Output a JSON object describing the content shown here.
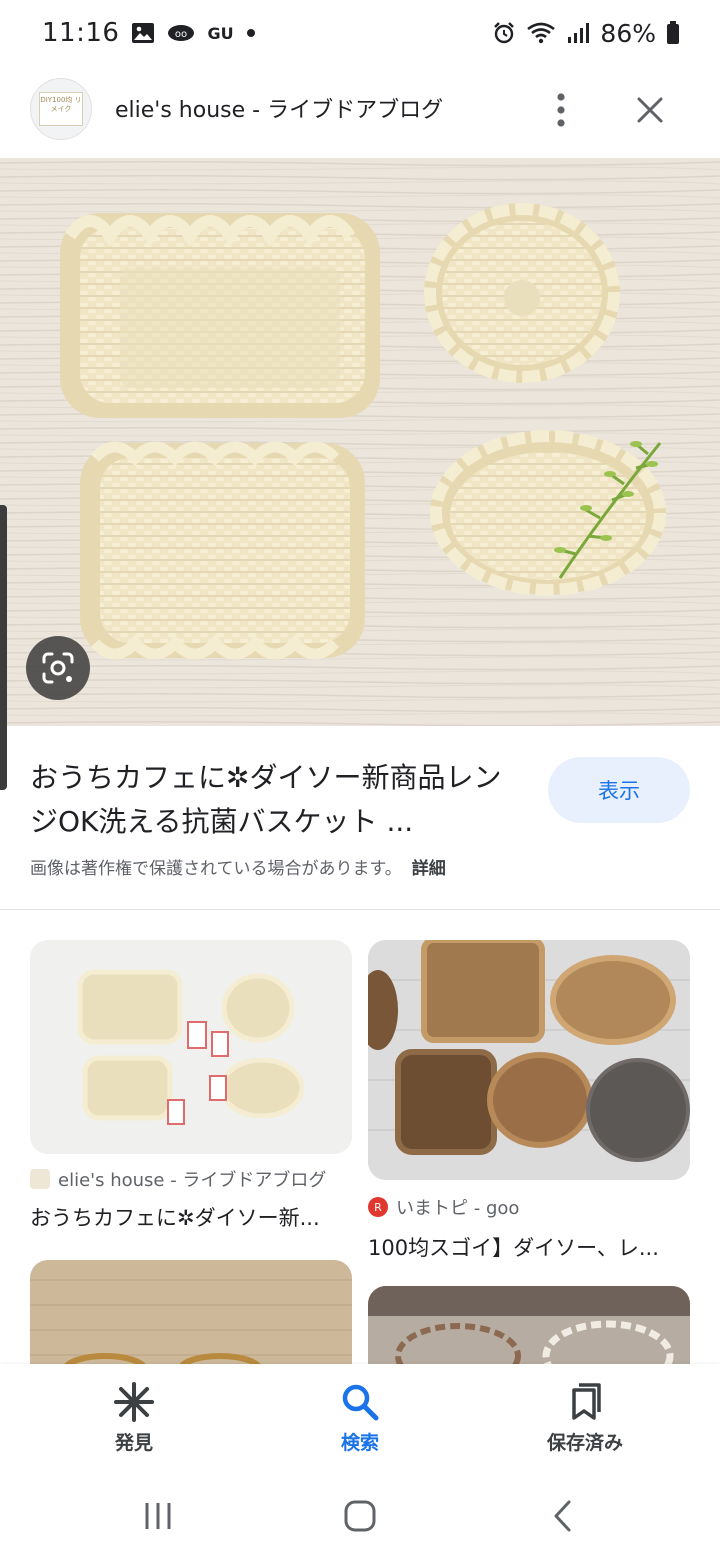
{
  "status_bar": {
    "time": "11:16",
    "carrier_small": "GU",
    "battery": "86%"
  },
  "header": {
    "site_title": "elie's house - ライブドアブログ",
    "avatar_text": "DIY100均 リメイク"
  },
  "caption": {
    "title_line1": "おうちカフェに✲ダイソー新商品レン",
    "title_line2": "ジOK洗える抗菌バスケット ...",
    "show_button": "表示",
    "copyright": "画像は著作権で保護されている場合があります。",
    "detail_link": "詳細"
  },
  "results": [
    {
      "source": "elie's house - ライブドアブログ",
      "title": "おうちカフェに✲ダイソー新..."
    },
    {
      "source": "いまトピ - goo",
      "title": "100均スゴイ】ダイソー、レ..."
    }
  ],
  "bottom_nav": {
    "discover": "発見",
    "search": "検索",
    "saved": "保存済み"
  },
  "colors": {
    "accent": "#1a73e8",
    "pill_bg": "#e8f0fe"
  }
}
